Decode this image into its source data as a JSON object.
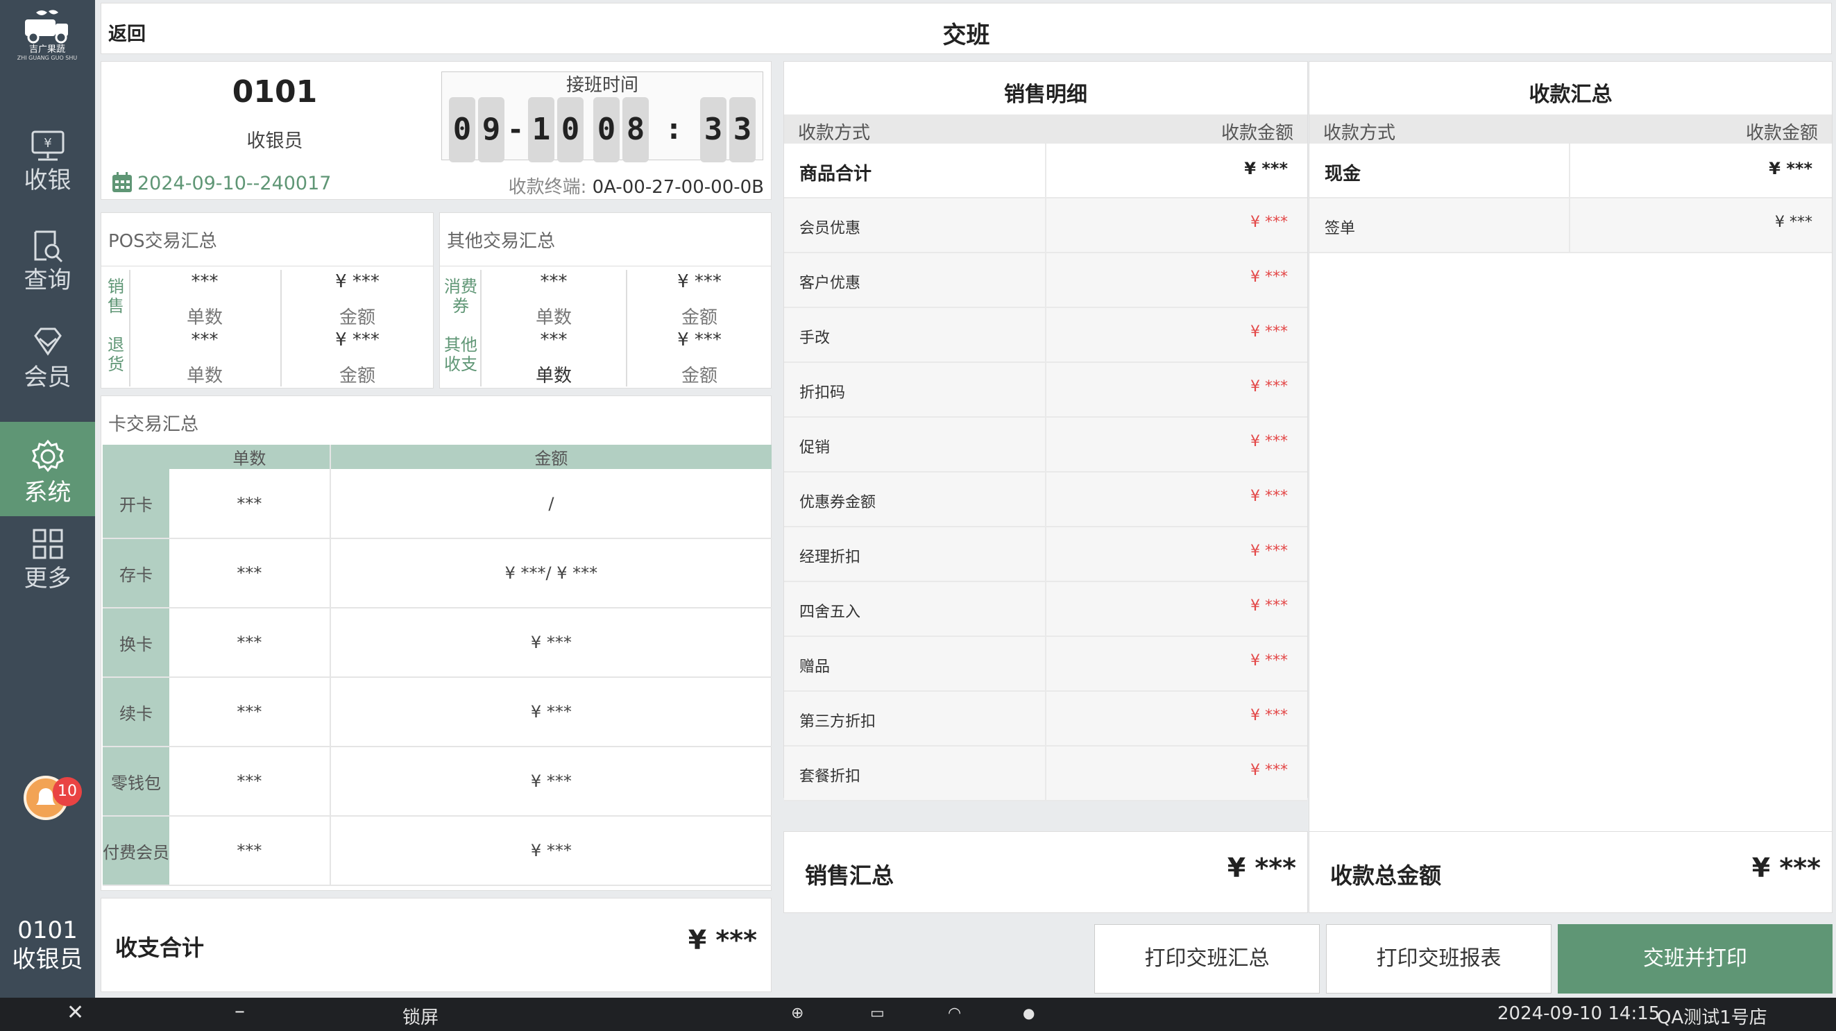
{
  "brand": {
    "name": "吉广果蔬",
    "sub": "ZHI GUANG GUO SHU"
  },
  "nav": [
    {
      "label": "收银",
      "icon": "cashier-icon"
    },
    {
      "label": "查询",
      "icon": "query-icon"
    },
    {
      "label": "会员",
      "icon": "diamond-icon"
    },
    {
      "label": "系统",
      "icon": "gear-icon",
      "active": true
    },
    {
      "label": "更多",
      "icon": "grid-icon"
    }
  ],
  "notifications": "10",
  "operator": {
    "id": "0101",
    "role": "收银员"
  },
  "header": {
    "back": "返回",
    "title": "交班"
  },
  "shift": {
    "cashier_id": "0101",
    "cashier_role": "收银员",
    "date_code": "2024-09-10--240017",
    "handover_label": "接班时间",
    "handover_time": [
      "0",
      "9",
      "-",
      "1",
      "0",
      "0",
      "8",
      ":",
      "3",
      "3"
    ],
    "terminal_label": "收款终端:",
    "terminal": "0A-00-27-00-00-0B"
  },
  "pos_summary": {
    "title": "POS交易汇总",
    "rows": [
      {
        "label": "销售",
        "count": "***",
        "count_label": "单数",
        "amount": "¥ ***",
        "amount_label": "金额"
      },
      {
        "label": "退货",
        "count": "***",
        "count_label": "单数",
        "amount": "¥ ***",
        "amount_label": "金额"
      }
    ]
  },
  "other_summary": {
    "title": "其他交易汇总",
    "rows": [
      {
        "label": "消费券",
        "count": "***",
        "count_label": "单数",
        "amount": "¥ ***",
        "amount_label": "金额"
      },
      {
        "label": "其他收支",
        "count": "***",
        "count_label": "单数",
        "amount": "¥ ***",
        "amount_label": "金额"
      }
    ]
  },
  "card_summary": {
    "title": "卡交易汇总",
    "headers": [
      "单数",
      "金额"
    ],
    "rows": [
      {
        "label": "开卡",
        "count": "***",
        "amount": "/"
      },
      {
        "label": "存卡",
        "count": "***",
        "amount": "¥ ***/ ¥ ***"
      },
      {
        "label": "换卡",
        "count": "***",
        "amount": "¥ ***"
      },
      {
        "label": "续卡",
        "count": "***",
        "amount": "¥ ***"
      },
      {
        "label": "零钱包",
        "count": "***",
        "amount": "¥ ***"
      },
      {
        "label": "付费会员",
        "count": "***",
        "amount": "¥ ***"
      }
    ]
  },
  "income_total": {
    "label": "收支合计",
    "value": "¥ ***"
  },
  "sales_detail": {
    "title": "销售明细",
    "col_left": "收款方式",
    "col_right": "收款金额",
    "rows": [
      {
        "label": "商品合计",
        "value": "¥ ***"
      },
      {
        "label": "会员优惠",
        "value": "¥ ***"
      },
      {
        "label": "客户优惠",
        "value": "¥ ***"
      },
      {
        "label": "手改",
        "value": "¥ ***"
      },
      {
        "label": "折扣码",
        "value": "¥ ***"
      },
      {
        "label": "促销",
        "value": "¥ ***"
      },
      {
        "label": "优惠券金额",
        "value": "¥ ***"
      },
      {
        "label": "经理折扣",
        "value": "¥ ***"
      },
      {
        "label": "四舍五入",
        "value": "¥ ***"
      },
      {
        "label": "赠品",
        "value": "¥ ***"
      },
      {
        "label": "第三方折扣",
        "value": "¥ ***"
      },
      {
        "label": "套餐折扣",
        "value": "¥ ***"
      }
    ],
    "total_label": "销售汇总",
    "total_value": "¥ ***"
  },
  "payment_summary": {
    "title": "收款汇总",
    "col_left": "收款方式",
    "col_right": "收款金额",
    "rows": [
      {
        "label": "现金",
        "value": "¥ ***"
      },
      {
        "label": "签单",
        "value": "¥ ***"
      }
    ],
    "total_label": "收款总金额",
    "total_value": "¥ ***"
  },
  "buttons": {
    "print_summary": "打印交班汇总",
    "print_report": "打印交班报表",
    "handover_print": "交班并打印"
  },
  "taskbar": {
    "lock": "锁屏",
    "datetime": "2024-09-10 14:15",
    "store": "QA测试1号店"
  },
  "colors": {
    "sidebar": "#3d4a56",
    "accent": "#5f9675",
    "header_green": "#b2cfc2",
    "discount_red": "#e34848"
  }
}
